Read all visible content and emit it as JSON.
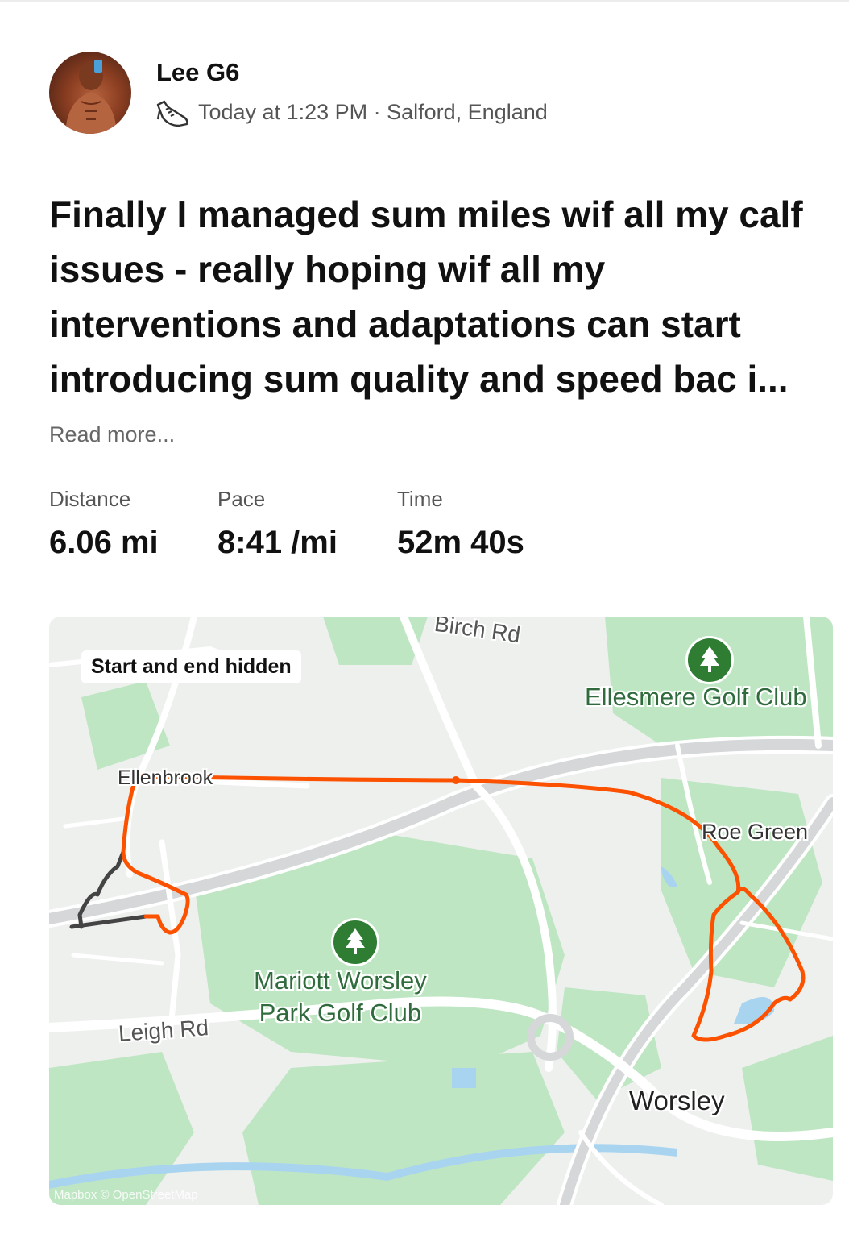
{
  "post": {
    "athlete_name": "Lee G6",
    "activity_icon": "running-shoe-icon",
    "time_text": "Today at 1:23 PM",
    "separator": " · ",
    "location": "Salford, England",
    "title": "Finally I managed sum miles wif all my calf issues - really hoping wif all my interventions and adaptations can start introducing sum quality and speed bac i...",
    "read_more": "Read more..."
  },
  "stats": [
    {
      "label": "Distance",
      "value": "6.06 mi"
    },
    {
      "label": "Pace",
      "value": "8:41 /mi"
    },
    {
      "label": "Time",
      "value": "52m 40s"
    }
  ],
  "map": {
    "badge": "Start and end hidden",
    "labels": {
      "birch_rd": "Birch Rd",
      "ellesmere": "Ellesmere Golf Club",
      "ellenbrook": "Ellenbrook",
      "roe_green": "Roe Green",
      "mariott_line1": "Mariott Worsley",
      "mariott_line2": "Park Golf Club",
      "leigh_rd": "Leigh Rd",
      "worsley": "Worsley"
    },
    "attribution": "Mapbox © OpenStreetMap",
    "colors": {
      "route": "#fc5200",
      "hidden_route": "#444444",
      "green": "#bfe6c3",
      "road": "#ffffff",
      "water": "#a9d4f0",
      "pin": "#2e7d32"
    }
  }
}
